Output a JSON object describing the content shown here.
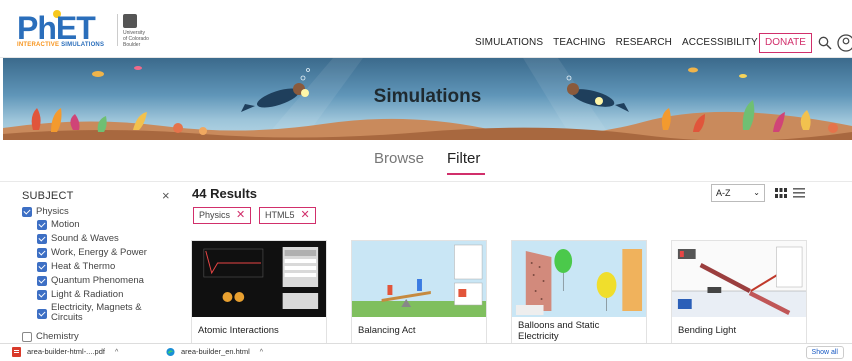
{
  "header": {
    "logo": {
      "name": "PhET",
      "tagline_bold": "INTERACTIVE",
      "tagline": "SIMULATIONS"
    },
    "university": {
      "lines": [
        "University",
        "of Colorado",
        "Boulder"
      ]
    },
    "nav": [
      "SIMULATIONS",
      "TEACHING",
      "RESEARCH",
      "ACCESSIBILITY"
    ],
    "donate_label": "DONATE",
    "icons": {
      "search": "search-icon",
      "account": "account-icon"
    }
  },
  "banner": {
    "title": "Simulations"
  },
  "tabs": {
    "browse": "Browse",
    "filter": "Filter",
    "active": "filter"
  },
  "sidebar": {
    "title": "SUBJECT",
    "close_glyph": "×",
    "parent": {
      "label": "Physics",
      "checked": true
    },
    "children": [
      {
        "label": "Motion",
        "checked": true
      },
      {
        "label": "Sound & Waves",
        "checked": true
      },
      {
        "label": "Work, Energy & Power",
        "checked": true
      },
      {
        "label": "Heat & Thermo",
        "checked": true
      },
      {
        "label": "Quantum Phenomena",
        "checked": true
      },
      {
        "label": "Light & Radiation",
        "checked": true
      },
      {
        "label": "Electricity, Magnets & Circuits",
        "checked": true
      }
    ],
    "next_parent": {
      "label": "Chemistry",
      "checked": false
    }
  },
  "results": {
    "count_label": "44 Results",
    "chips": [
      {
        "label": "Physics",
        "remove": "✕"
      },
      {
        "label": "HTML5",
        "remove": "✕"
      }
    ],
    "sort": {
      "value": "A-Z",
      "chevron": "⌄"
    },
    "cards": [
      {
        "title": "Atomic Interactions"
      },
      {
        "title": "Balancing Act"
      },
      {
        "title": "Balloons and Static Electricity"
      },
      {
        "title": "Bending Light"
      }
    ]
  },
  "downloads": {
    "items": [
      {
        "name": "area-builder-html-....pdf",
        "icon": "pdf-icon"
      },
      {
        "name": "area-builder_en.html",
        "icon": "edge-icon"
      }
    ],
    "chevron": "^",
    "show_all": "Show all"
  },
  "colors": {
    "accent": "#d12f6b",
    "checkbox": "#3d6fc4",
    "phet_blue": "#2a6ebb",
    "phet_orange": "#f7941d"
  }
}
